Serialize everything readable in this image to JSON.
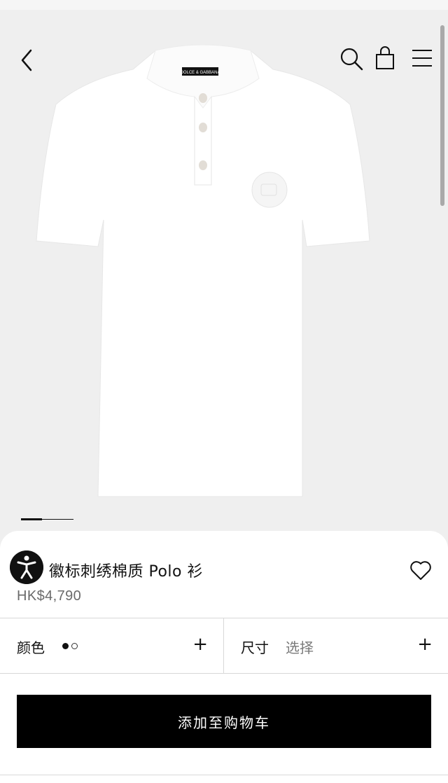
{
  "product": {
    "title": "徽标刺绣棉质 Polo 衫",
    "price": "HK$4,790",
    "brand_label": "DOLCE & GABBANA"
  },
  "options": {
    "color_label": "颜色",
    "size_label": "尺寸",
    "size_hint": "选择",
    "color_swatches": [
      "#111111",
      "#ffffff"
    ],
    "plus": "+"
  },
  "cta": {
    "add_to_cart": "添加至购物车"
  },
  "carousel": {
    "current": 1,
    "total": 2
  },
  "icons": {
    "back": "chevron-left-icon",
    "search": "search-icon",
    "bag": "shopping-bag-icon",
    "menu": "hamburger-menu-icon",
    "wishlist": "heart-icon",
    "accessibility": "accessibility-icon"
  }
}
